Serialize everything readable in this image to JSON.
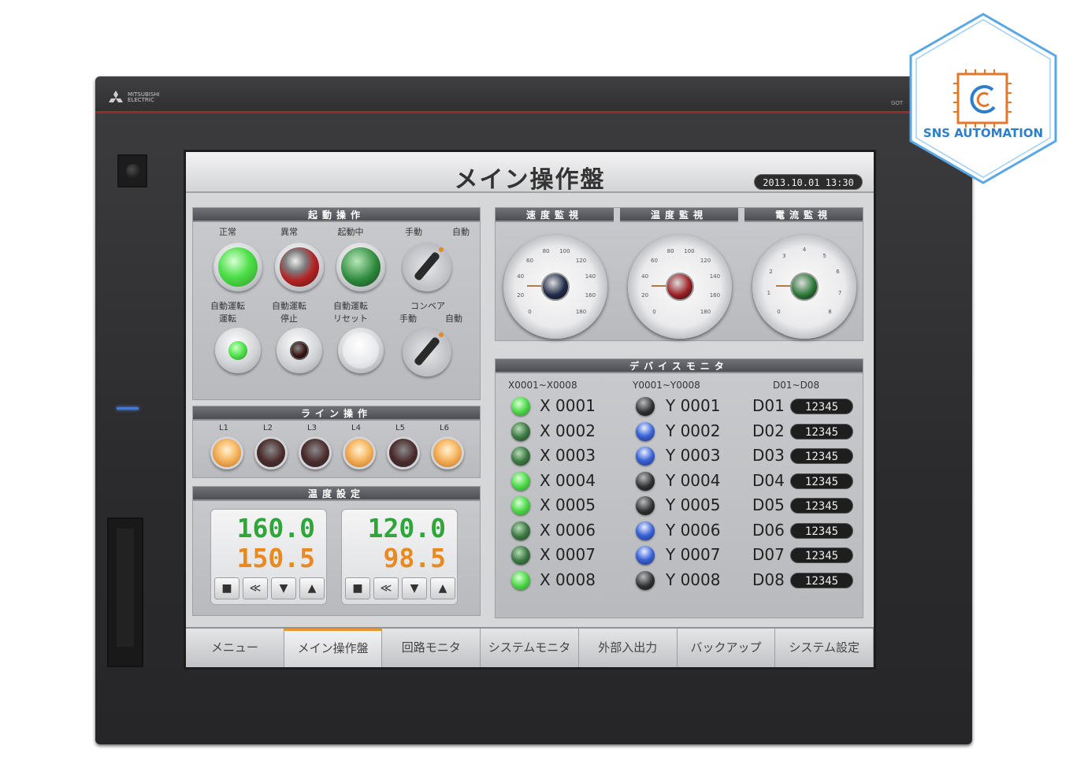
{
  "device": {
    "brand_line1": "MITSUBISHI",
    "brand_line2": "ELECTRIC",
    "model": "GOT"
  },
  "screen": {
    "title": "メイン操作盤",
    "datetime": "2013.10.01 13:30",
    "start_ops": {
      "header": "起動操作",
      "row1_labels": [
        "正常",
        "異常",
        "起動中",
        "手動",
        "自動"
      ],
      "row2_labels": [
        "自動運転\n運転",
        "自動運転\n停止",
        "自動運転\nリセット",
        "コンベア"
      ],
      "conveyor_labels": [
        "手動",
        "自動"
      ],
      "lamp_colors": {
        "normal": "#4fe04a",
        "abnormal": "#b42424",
        "running": "#2e8a3c"
      }
    },
    "line_ops": {
      "header": "ライン操作",
      "labels": [
        "L1",
        "L2",
        "L3",
        "L4",
        "L5",
        "L6"
      ],
      "states": [
        "on",
        "off",
        "off",
        "on",
        "off",
        "on"
      ]
    },
    "temp_setting": {
      "header": "温度設定",
      "units": [
        {
          "setpoint": "160.0",
          "actual": "150.5"
        },
        {
          "setpoint": "120.0",
          "actual": "98.5"
        }
      ],
      "buttons": [
        "■",
        "≪",
        "▼",
        "▲"
      ]
    },
    "gauges": [
      {
        "header": "速度監視",
        "ticks": [
          "0",
          "20",
          "40",
          "60",
          "80",
          "100",
          "120",
          "140",
          "160",
          "180"
        ],
        "hub": "#1f2b4a"
      },
      {
        "header": "温度監視",
        "ticks": [
          "0",
          "20",
          "40",
          "60",
          "80",
          "100",
          "120",
          "140",
          "160",
          "180"
        ],
        "hub": "#9c1f24"
      },
      {
        "header": "電流監視",
        "ticks": [
          "0",
          "1",
          "2",
          "3",
          "4",
          "5",
          "6",
          "7",
          "8"
        ],
        "hub": "#2c7a38"
      }
    ],
    "device_monitor": {
      "header": "デバイスモニタ",
      "columns": [
        "X0001~X0008",
        "Y0001~Y0008",
        "D01~D08"
      ],
      "x": [
        {
          "name": "X 0001",
          "on": true
        },
        {
          "name": "X 0002",
          "on": false
        },
        {
          "name": "X 0003",
          "on": false
        },
        {
          "name": "X 0004",
          "on": true
        },
        {
          "name": "X 0005",
          "on": true
        },
        {
          "name": "X 0006",
          "on": false
        },
        {
          "name": "X 0007",
          "on": false
        },
        {
          "name": "X 0008",
          "on": true
        }
      ],
      "y": [
        {
          "name": "Y 0001",
          "on": false
        },
        {
          "name": "Y 0002",
          "on": true
        },
        {
          "name": "Y 0003",
          "on": true
        },
        {
          "name": "Y 0004",
          "on": false
        },
        {
          "name": "Y 0005",
          "on": false
        },
        {
          "name": "Y 0006",
          "on": true
        },
        {
          "name": "Y 0007",
          "on": true
        },
        {
          "name": "Y 0008",
          "on": false
        }
      ],
      "d": [
        {
          "name": "D01",
          "value": "12345"
        },
        {
          "name": "D02",
          "value": "12345"
        },
        {
          "name": "D03",
          "value": "12345"
        },
        {
          "name": "D04",
          "value": "12345"
        },
        {
          "name": "D05",
          "value": "12345"
        },
        {
          "name": "D06",
          "value": "12345"
        },
        {
          "name": "D07",
          "value": "12345"
        },
        {
          "name": "D08",
          "value": "12345"
        }
      ]
    },
    "tabs": [
      "メニュー",
      "メイン操作盤",
      "回路モニタ",
      "システムモニタ",
      "外部入出力",
      "バックアップ",
      "システム設定"
    ],
    "active_tab": "メイン操作盤"
  },
  "watermark": {
    "text": "SNS AUTOMATION"
  }
}
